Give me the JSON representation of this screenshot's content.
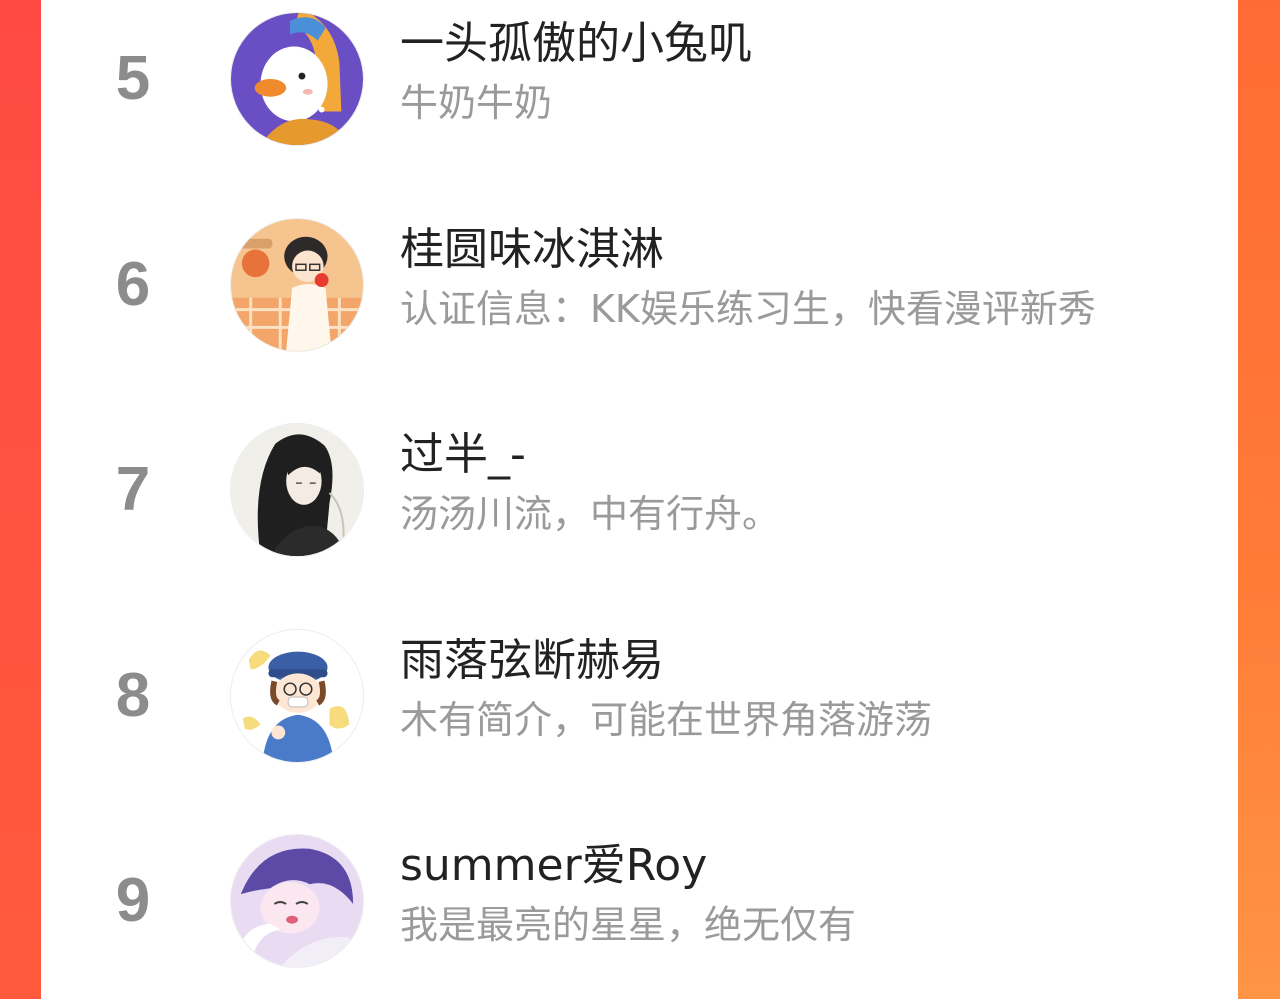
{
  "colors": {
    "accent_left": "#ff4a44",
    "accent_right": "#ff7a36",
    "rank_number": "#8c8c8c",
    "name_text": "#222222",
    "bio_text": "#9a9a9a"
  },
  "ranking": {
    "items": [
      {
        "rank": "5",
        "name": "一头孤傲的小兔叽",
        "bio": "牛奶牛奶",
        "avatar_icon": "duck-avatar-icon"
      },
      {
        "rank": "6",
        "name": "桂圆味冰淇淋",
        "bio": "认证信息：KK娱乐练习生，快看漫评新秀",
        "avatar_icon": "boy-eating-avatar-icon"
      },
      {
        "rank": "7",
        "name": "过半_-",
        "bio": "汤汤川流，中有行舟。",
        "avatar_icon": "longhair-avatar-icon"
      },
      {
        "rank": "8",
        "name": "雨落弦断赫易",
        "bio": "木有简介，可能在世界角落游荡",
        "avatar_icon": "cartoon-hat-avatar-icon"
      },
      {
        "rank": "9",
        "name": "summer爱Roy",
        "bio": "我是最亮的星星，绝无仅有",
        "avatar_icon": "anime-boy-avatar-icon"
      }
    ]
  }
}
